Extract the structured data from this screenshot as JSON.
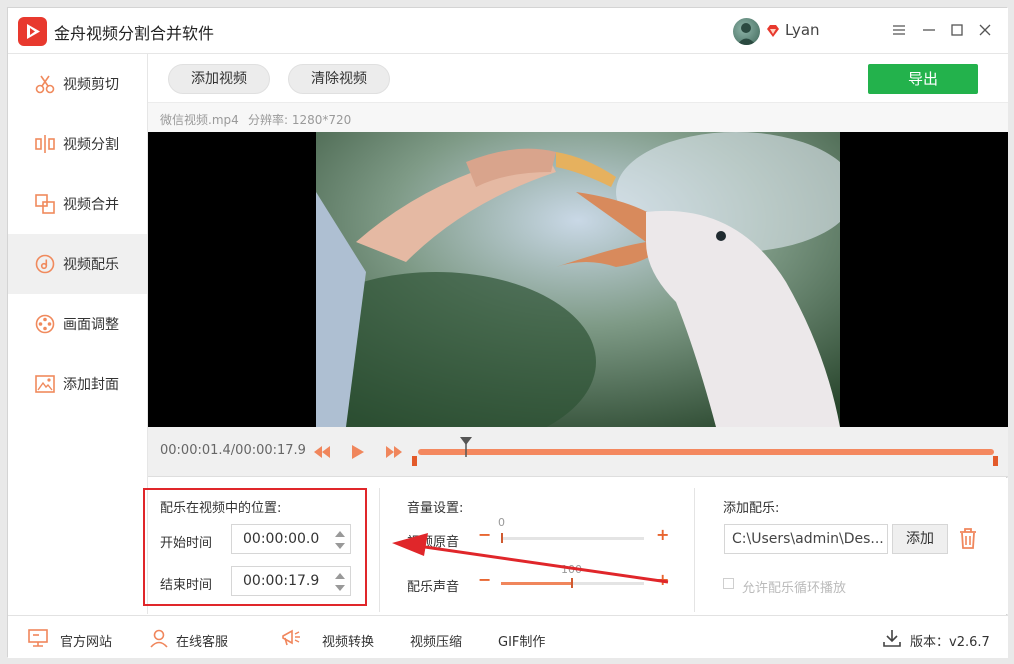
{
  "app": {
    "title": "金舟视频分割合并软件",
    "user_name": "Lyan"
  },
  "toolbar": {
    "add_video": "添加视频",
    "clear_video": "清除视频",
    "export": "导出"
  },
  "sidebar": {
    "items": [
      {
        "label": "视频剪切",
        "icon": "scissors-icon"
      },
      {
        "label": "视频分割",
        "icon": "split-icon"
      },
      {
        "label": "视频合并",
        "icon": "merge-icon"
      },
      {
        "label": "视频配乐",
        "icon": "music-icon",
        "active": true
      },
      {
        "label": "画面调整",
        "icon": "film-reel-icon"
      },
      {
        "label": "添加封面",
        "icon": "image-icon"
      }
    ]
  },
  "file": {
    "name": "微信视频.mp4",
    "resolution": "分辨率: 1280*720"
  },
  "player": {
    "timecode": "00:00:01.4/00:00:17.9",
    "progress": 0.08
  },
  "position_panel": {
    "title": "配乐在视频中的位置:",
    "start_label": "开始时间",
    "start_value": "00:00:00.0",
    "end_label": "结束时间",
    "end_value": "00:00:17.9"
  },
  "volume_panel": {
    "title": "音量设置:",
    "original_label": "视频原音",
    "original_value": "0",
    "music_label": "配乐声音",
    "music_value": "100"
  },
  "music_panel": {
    "title": "添加配乐:",
    "path": "C:\\Users\\admin\\Des...",
    "add_label": "添加",
    "loop_label": "允许配乐循环播放"
  },
  "footer": {
    "website": "官方网站",
    "service": "在线客服",
    "convert": "视频转换",
    "compress": "视频压缩",
    "gif": "GIF制作",
    "version": "版本：v2.6.7"
  },
  "colors": {
    "accent": "#f0865c",
    "export_green": "#23b24c",
    "brand_red": "#e8392e",
    "highlight_red": "#e0262a"
  }
}
